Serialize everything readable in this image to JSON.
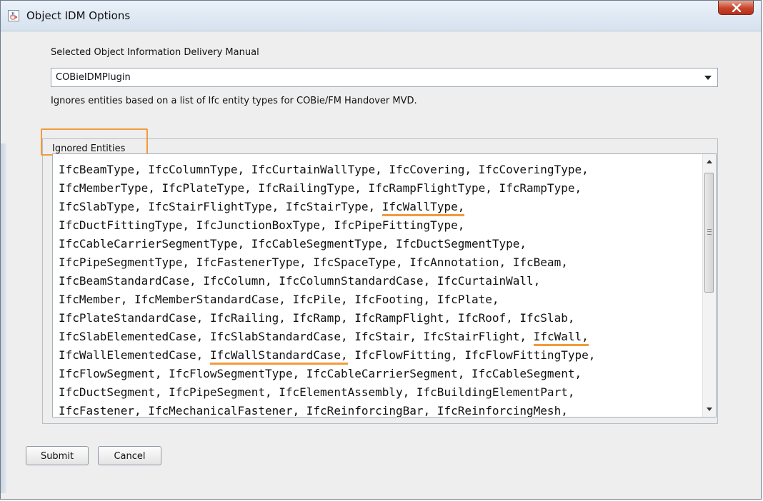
{
  "window": {
    "title": "Object IDM Options",
    "icons": {
      "app": "java-cup-icon",
      "close": "close-x-icon"
    }
  },
  "idm": {
    "label": "Selected Object Information Delivery Manual",
    "selected": "COBieIDMPlugin",
    "description": "Ignores entities based on a list of Ifc entity types for COBie/FM Handover MVD."
  },
  "ignored": {
    "label": "Ignored Entities",
    "lines": [
      [
        {
          "t": "IfcBeamType, IfcColumnType, IfcCurtainWallType, IfcCovering, IfcCoveringType,"
        }
      ],
      [
        {
          "t": "IfcMemberType, IfcPlateType, IfcRailingType, IfcRampFlightType, IfcRampType,"
        }
      ],
      [
        {
          "t": "IfcSlabType, IfcStairFlightType, IfcStairType, "
        },
        {
          "t": "IfcWallType,",
          "hl": true
        }
      ],
      [
        {
          "t": "IfcDuctFittingType, IfcJunctionBoxType, IfcPipeFittingType,"
        }
      ],
      [
        {
          "t": "IfcCableCarrierSegmentType, IfcCableSegmentType, IfcDuctSegmentType,"
        }
      ],
      [
        {
          "t": "IfcPipeSegmentType, IfcFastenerType, IfcSpaceType, IfcAnnotation, IfcBeam,"
        }
      ],
      [
        {
          "t": "IfcBeamStandardCase, IfcColumn, IfcColumnStandardCase, IfcCurtainWall,"
        }
      ],
      [
        {
          "t": "IfcMember, IfcMemberStandardCase, IfcPile, IfcFooting, IfcPlate,"
        }
      ],
      [
        {
          "t": "IfcPlateStandardCase, IfcRailing, IfcRamp, IfcRampFlight, IfcRoof, IfcSlab,"
        }
      ],
      [
        {
          "t": "IfcSlabElementedCase, IfcSlabStandardCase, IfcStair, IfcStairFlight, "
        },
        {
          "t": "IfcWall,",
          "hl": true
        }
      ],
      [
        {
          "t": "IfcWallElementedCase, "
        },
        {
          "t": "IfcWallStandardCase,",
          "hl": true
        },
        {
          "t": " IfcFlowFitting, IfcFlowFittingType,"
        }
      ],
      [
        {
          "t": "IfcFlowSegment, IfcFlowSegmentType, IfcCableCarrierSegment, IfcCableSegment,"
        }
      ],
      [
        {
          "t": "IfcDuctSegment, IfcPipeSegment, IfcElementAssembly, IfcBuildingElementPart,"
        }
      ],
      [
        {
          "t": "IfcFastener, IfcMechanicalFastener, IfcReinforcingBar, IfcReinforcingMesh,"
        }
      ]
    ],
    "highlight_color": "#f39a3a"
  },
  "buttons": {
    "submit": "Submit",
    "cancel": "Cancel"
  }
}
